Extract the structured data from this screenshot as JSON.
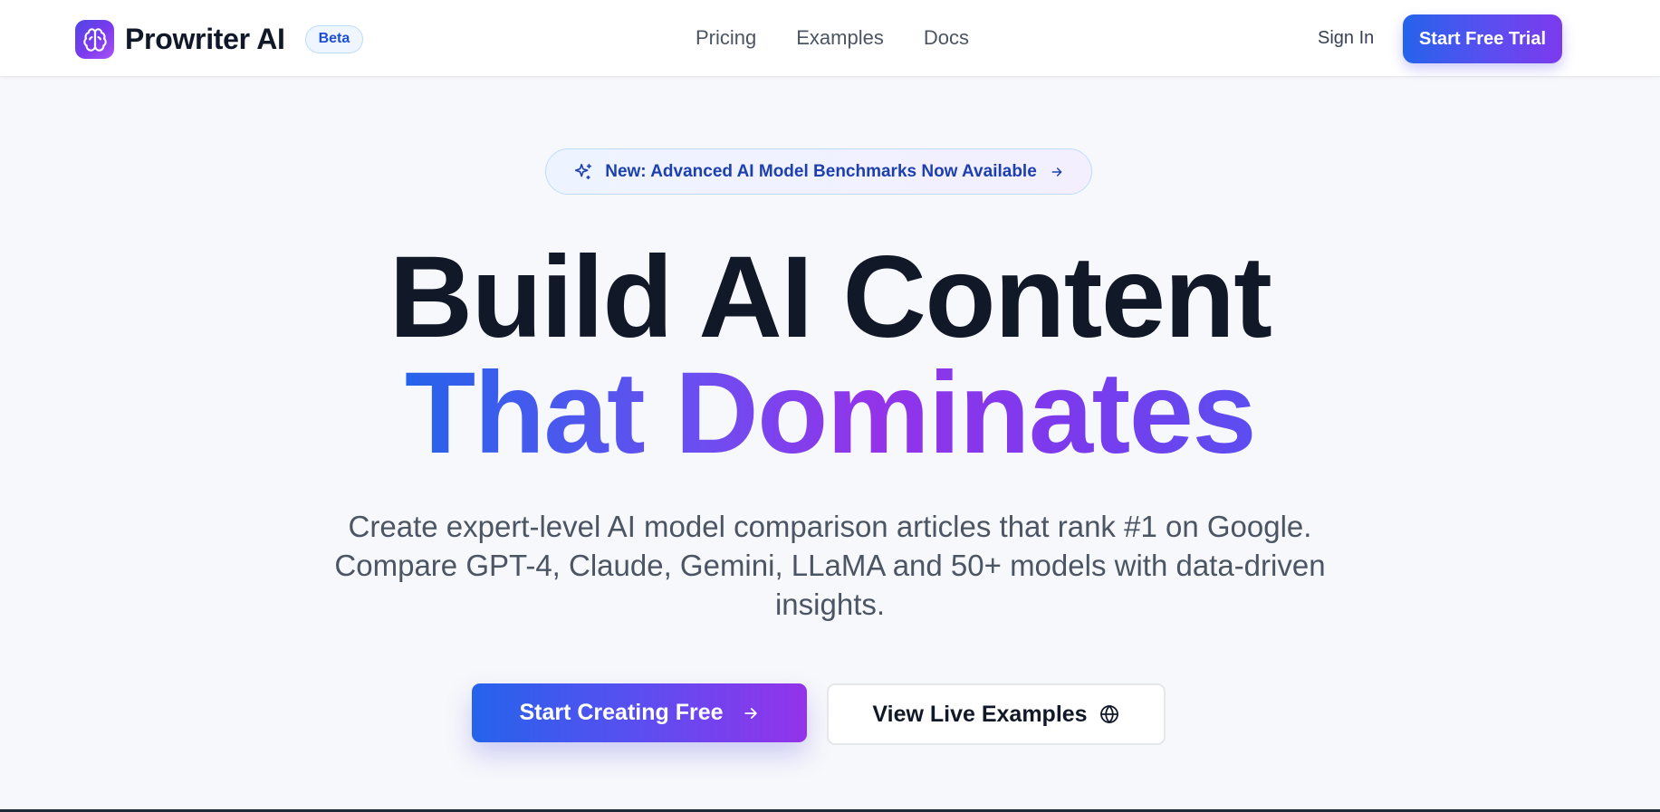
{
  "header": {
    "brand": "Prowriter AI",
    "badge": "Beta",
    "nav": [
      "Pricing",
      "Examples",
      "Docs"
    ],
    "sign_in": "Sign In",
    "trial_button": "Start Free Trial"
  },
  "announcement": {
    "text": "New: Advanced AI Model Benchmarks Now Available",
    "icon": "sparkles-icon"
  },
  "hero": {
    "line1": "Build AI Content",
    "line2": "That Dominates",
    "subtitle_lines": [
      "Create expert-level AI model comparison articles that rank #1 on Google.",
      "Compare GPT-4, Claude, Gemini, LLaMA and 50+ models with data-driven",
      "insights."
    ]
  },
  "cta": {
    "primary": "Start Creating Free",
    "secondary": "View Live Examples"
  },
  "colors": {
    "brand_blue": "#2563eb",
    "brand_purple": "#9333ea",
    "headline_dark": "#111827",
    "body_gray": "#4b5563"
  }
}
